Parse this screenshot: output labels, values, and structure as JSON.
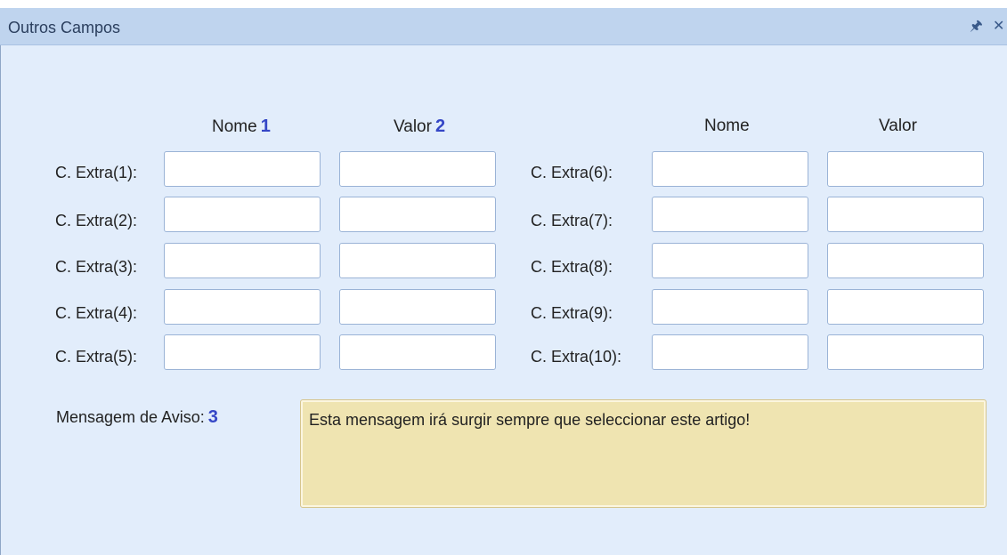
{
  "window": {
    "title": "Outros Campos",
    "pin_icon": "pin-icon",
    "close_icon": "close-icon"
  },
  "headers": {
    "left_name": "Nome",
    "left_name_badge": "1",
    "left_value": "Valor",
    "left_value_badge": "2",
    "right_name": "Nome",
    "right_value": "Valor"
  },
  "rows": {
    "left": [
      {
        "label": "C. Extra(1):",
        "name": "",
        "value": ""
      },
      {
        "label": "C. Extra(2):",
        "name": "",
        "value": ""
      },
      {
        "label": "C. Extra(3):",
        "name": "",
        "value": ""
      },
      {
        "label": "C. Extra(4):",
        "name": "",
        "value": ""
      },
      {
        "label": "C. Extra(5):",
        "name": "",
        "value": ""
      }
    ],
    "right": [
      {
        "label": "C. Extra(6):",
        "name": "",
        "value": ""
      },
      {
        "label": "C. Extra(7):",
        "name": "",
        "value": ""
      },
      {
        "label": "C. Extra(8):",
        "name": "",
        "value": ""
      },
      {
        "label": "C. Extra(9):",
        "name": "",
        "value": ""
      },
      {
        "label": "C. Extra(10):",
        "name": "",
        "value": ""
      }
    ]
  },
  "aviso": {
    "label": "Mensagem de Aviso:",
    "badge": "3",
    "message": "Esta mensagem irá surgir sempre que seleccionar este artigo!",
    "background": "#efe4b1"
  },
  "colors": {
    "panel": "#e2edfb",
    "titlebar": "#bfd4ee",
    "badge": "#3446c6"
  }
}
